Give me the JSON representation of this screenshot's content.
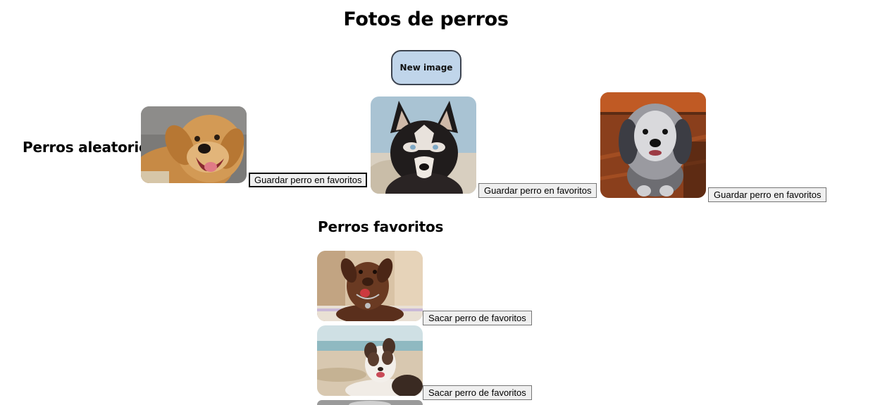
{
  "page": {
    "title": "Fotos de perros",
    "new_image_button": "New image"
  },
  "random_section": {
    "heading": "Perros aleatorios",
    "dogs": [
      {
        "alt": "golden retriever",
        "save_label": "Guardar perro en favoritos"
      },
      {
        "alt": "husky",
        "save_label": "Guardar perro en favoritos"
      },
      {
        "alt": "sheepdog",
        "save_label": "Guardar perro en favoritos"
      }
    ]
  },
  "favorites_section": {
    "heading": "Perros favoritos",
    "dogs": [
      {
        "alt": "chocolate labrador",
        "remove_label": "Sacar perro de favoritos"
      },
      {
        "alt": "australian shepherd",
        "remove_label": "Sacar perro de favoritos"
      },
      {
        "alt": "dog (partially visible)"
      }
    ]
  },
  "colors": {
    "new_image_button_bg": "#c0d5ea",
    "new_image_button_border": "#3d4450",
    "button_bg": "#efefef",
    "button_border": "#767676"
  }
}
